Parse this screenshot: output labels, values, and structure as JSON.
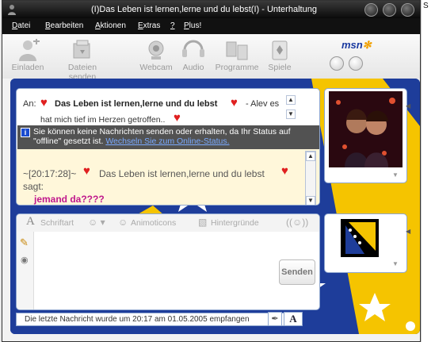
{
  "window": {
    "title": "(I)Das Leben ist lernen,lerne und du lebst(I) - Unterhaltung"
  },
  "menu": {
    "items": [
      {
        "label": "Datei",
        "u": "D",
        "rest": "atei"
      },
      {
        "label": "Bearbeiten",
        "u": "B",
        "rest": "earbeiten"
      },
      {
        "label": "Aktionen",
        "u": "A",
        "rest": "ktionen"
      },
      {
        "label": "Extras",
        "u": "E",
        "rest": "xtras"
      },
      {
        "label": "?",
        "u": "?",
        "rest": ""
      },
      {
        "label": "Plus!",
        "u": "P",
        "rest": "lus!"
      }
    ]
  },
  "toolbar": {
    "items": [
      {
        "label": "Einladen",
        "icon": "invite-icon"
      },
      {
        "label": "Dateien senden",
        "icon": "send-files-icon"
      },
      {
        "label": "Webcam",
        "icon": "webcam-icon"
      },
      {
        "label": "Audio",
        "icon": "audio-icon"
      },
      {
        "label": "Programme",
        "icon": "programs-icon"
      },
      {
        "label": "Spiele",
        "icon": "games-icon"
      }
    ],
    "logo": "msn"
  },
  "conversation": {
    "to_label": "An:",
    "contact_name": "Das Leben ist lernen,lerne und du lebst",
    "contact_suffix": "- Alev es",
    "contact_message": "hat mich tief im Herzen getroffen..",
    "warning_text": "Sie können keine Nachrichten senden oder erhalten, da Ihr Status auf \"offline\" gesetzt ist.",
    "warning_link": "Wechseln Sie zum Online-Status.",
    "message_prefix": "~[20:17:28]~",
    "message_sender": "Das Leben ist lernen,lerne und du lebst",
    "message_says": "sagt:",
    "message_text": "jemand da????"
  },
  "compose": {
    "font_label": "Schriftart",
    "animoticons_label": "Animoticons",
    "backgrounds_label": "Hintergründe",
    "send_label": "Senden"
  },
  "statusbar": {
    "text": "Die letzte Nachricht wurde um 20:17 am 01.05.2005 empfangen"
  },
  "colors": {
    "heart": "#e02020",
    "message_text": "#c0188c",
    "flag_blue": "#1e3d9a",
    "flag_yellow": "#f5c400",
    "link": "#7aaaff"
  }
}
